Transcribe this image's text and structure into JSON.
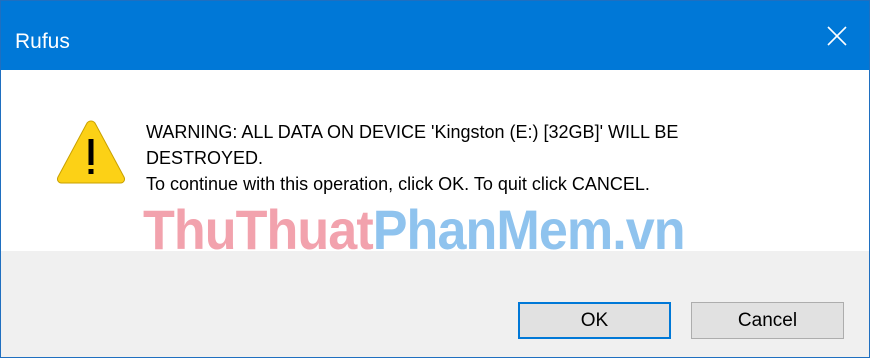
{
  "window": {
    "title": "Rufus",
    "close_icon": "close-icon"
  },
  "message": {
    "icon": "warning-icon",
    "line1": "WARNING: ALL DATA ON DEVICE 'Kingston (E:) [32GB]' WILL BE",
    "line2": "DESTROYED.",
    "line3": "To continue with this operation, click OK. To quit click CANCEL."
  },
  "watermark": {
    "part1": "ThuThuat",
    "part2": "PhanMem.vn",
    "color1": "#f2a2ad",
    "color2": "#8fc3ee"
  },
  "buttons": {
    "ok_label": "OK",
    "cancel_label": "Cancel"
  },
  "colors": {
    "titlebar": "#0078d7",
    "footer": "#f0f0f0",
    "warning_fill": "#fcd116"
  }
}
